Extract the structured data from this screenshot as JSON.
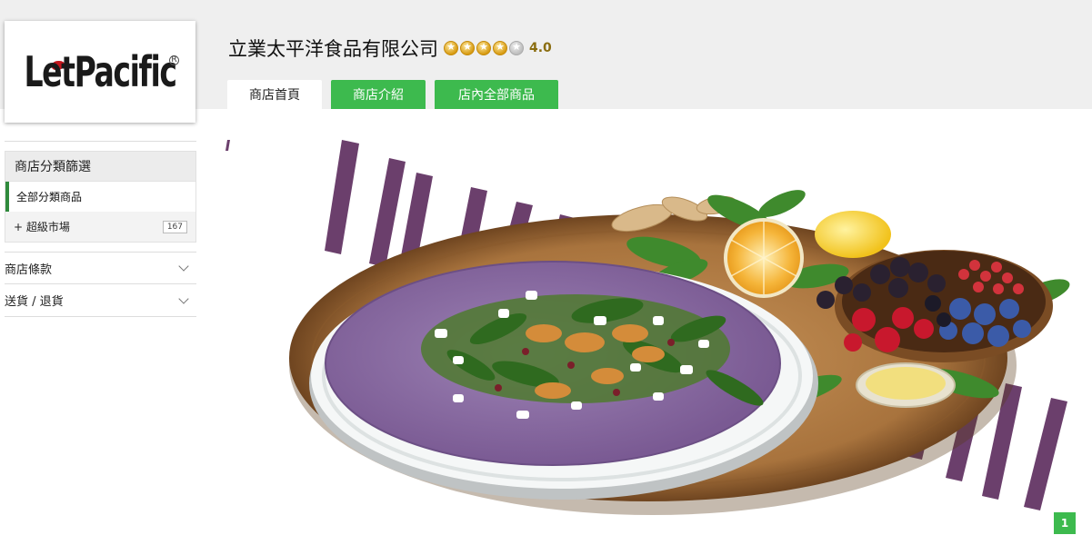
{
  "store": {
    "logo_text": "LetPacific",
    "name": "立業太平洋食品有限公司",
    "rating": "4.0",
    "rating_value": 4,
    "rating_max": 5
  },
  "tabs": [
    {
      "label": "商店首頁",
      "active": true
    },
    {
      "label": "商店介紹",
      "active": false
    },
    {
      "label": "店內全部商品",
      "active": false
    }
  ],
  "sidebar": {
    "category_header": "商店分類篩選",
    "all_categories": "全部分類商品",
    "categories": [
      {
        "label": "+ 超級市場",
        "count": "167"
      }
    ],
    "accordion": [
      {
        "label": "商店條款"
      },
      {
        "label": "送貨 / 退貨"
      }
    ]
  },
  "banner": {
    "page": "1",
    "icon": "food-banner-image"
  },
  "colors": {
    "accent_green": "#3dba4e",
    "active_border": "#2f8a3c",
    "stripe_purple": "#6b3f6c",
    "tortilla_purple": "#8e6fa6"
  }
}
